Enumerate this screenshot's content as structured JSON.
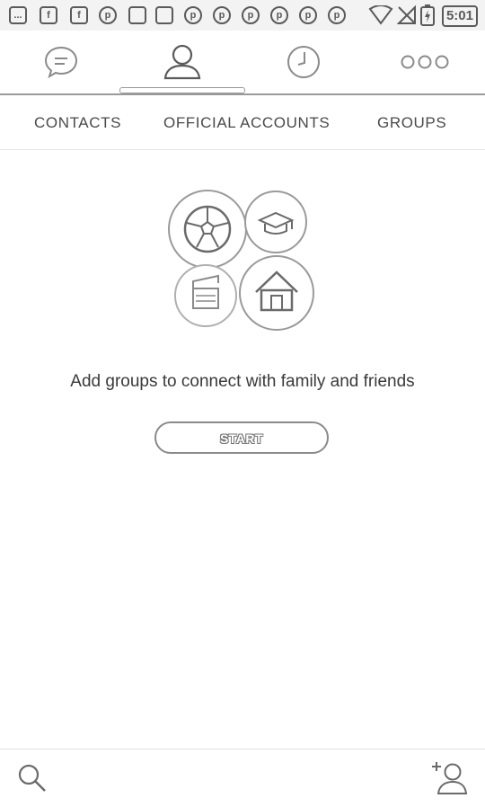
{
  "status_bar": {
    "time": "5:01",
    "notifications": [
      "more-icon",
      "facebook-icon",
      "facebook-icon",
      "pinterest-icon",
      "cat-icon",
      "cat-icon",
      "pinterest-icon",
      "pinterest-icon",
      "pinterest-icon",
      "pinterest-icon",
      "pinterest-icon",
      "pinterest-icon"
    ],
    "notification_letters": [
      "...",
      "f",
      "f",
      "p",
      "",
      "",
      "p",
      "p",
      "p",
      "p",
      "p",
      "p"
    ]
  },
  "top_nav": {
    "items": [
      {
        "name": "chats-tab",
        "icon": "chat-bubble-icon"
      },
      {
        "name": "contacts-tab",
        "icon": "person-icon",
        "active": true
      },
      {
        "name": "recent-tab",
        "icon": "clock-icon"
      },
      {
        "name": "more-tab",
        "icon": "more-dots-icon"
      }
    ]
  },
  "tabs": {
    "contacts": "CONTACTS",
    "official_accounts": "OFFICIAL ACCOUNTS",
    "groups": "GROUPS"
  },
  "empty_state": {
    "message": "Add groups to connect with family and friends",
    "start_label": "START",
    "illustration_icons": [
      "soccer-ball-icon",
      "graduation-cap-icon",
      "clapperboard-icon",
      "house-icon"
    ]
  },
  "bottom_bar": {
    "left_icon": "search-icon",
    "right_icon": "add-contact-icon"
  },
  "colors": {
    "text": "#3a3a3a",
    "divider": "#9a9a9a",
    "background": "#ffffff"
  }
}
